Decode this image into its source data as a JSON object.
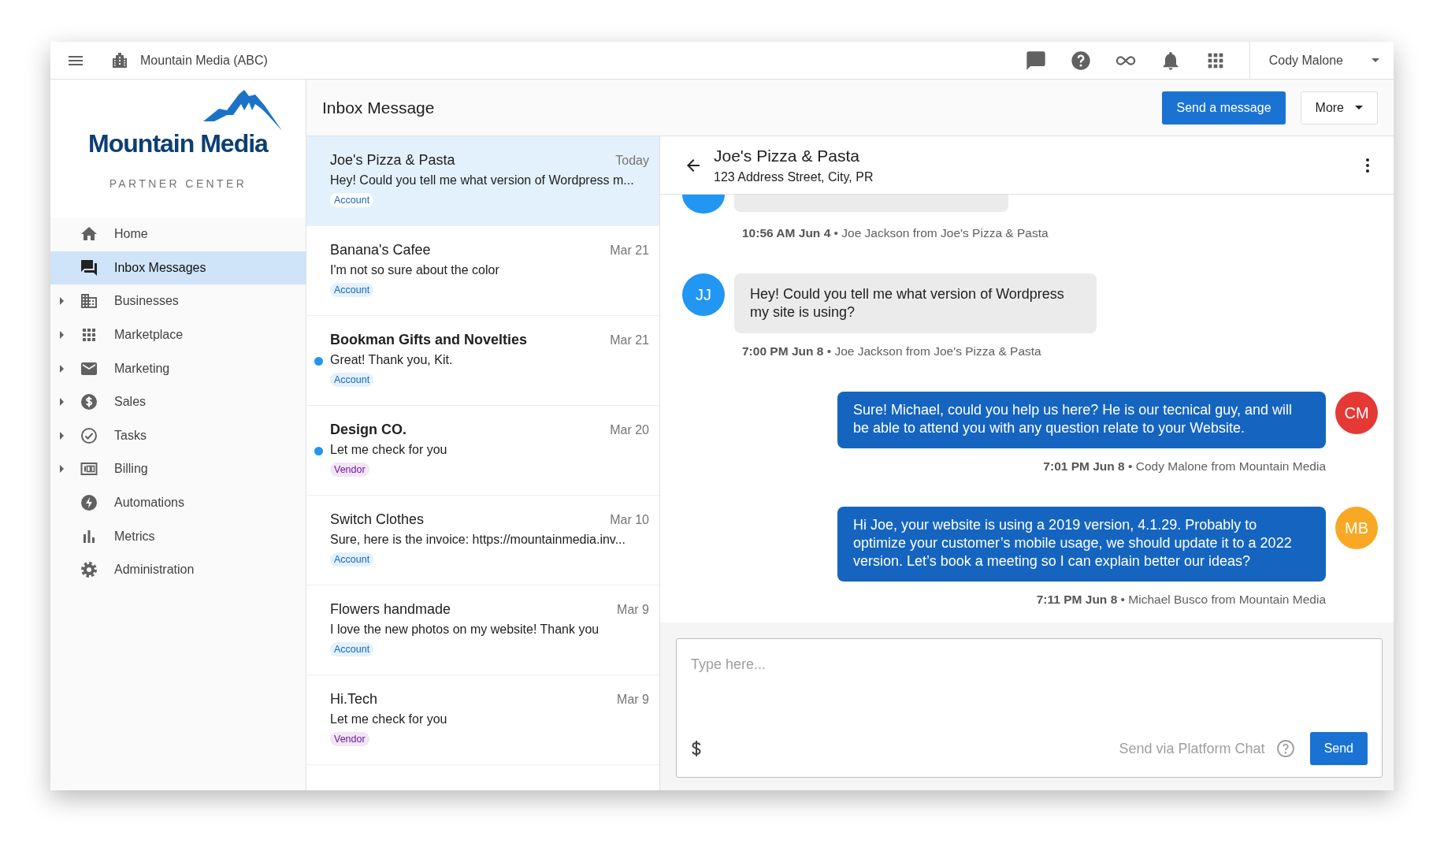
{
  "topbar": {
    "org": "Mountain Media (ABC)",
    "user": "Cody Malone"
  },
  "logo": {
    "name": "Mountain Media",
    "subtitle": "PARTNER CENTER"
  },
  "sidebar": {
    "items": [
      {
        "label": "Home",
        "expandable": false,
        "selected": false
      },
      {
        "label": "Inbox Messages",
        "expandable": false,
        "selected": true
      },
      {
        "label": "Businesses",
        "expandable": true,
        "selected": false
      },
      {
        "label": "Marketplace",
        "expandable": true,
        "selected": false
      },
      {
        "label": "Marketing",
        "expandable": true,
        "selected": false
      },
      {
        "label": "Sales",
        "expandable": true,
        "selected": false
      },
      {
        "label": "Tasks",
        "expandable": true,
        "selected": false
      },
      {
        "label": "Billing",
        "expandable": true,
        "selected": false
      },
      {
        "label": "Automations",
        "expandable": false,
        "selected": false
      },
      {
        "label": "Metrics",
        "expandable": false,
        "selected": false
      },
      {
        "label": "Administration",
        "expandable": false,
        "selected": false
      }
    ]
  },
  "page": {
    "title": "Inbox Message",
    "buttons": [
      {
        "label": "Send a message",
        "kind": "primary"
      },
      {
        "label": "More",
        "kind": "menu"
      }
    ]
  },
  "conversations": [
    {
      "name": "Joe's Pizza & Pasta",
      "date": "Today",
      "preview": "Hey! Could you tell me what version of Wordpress m...",
      "tag": {
        "label": "Account",
        "kind": "account"
      },
      "unread": false,
      "selected": true
    },
    {
      "name": "Banana's Cafee",
      "date": "Mar 21",
      "preview": "I'm not so sure about the color",
      "tag": {
        "label": "Account",
        "kind": "account"
      },
      "unread": false,
      "selected": false
    },
    {
      "name": "Bookman Gifts and Novelties",
      "date": "Mar 21",
      "preview": "Great! Thank you, Kit.",
      "tag": {
        "label": "Account",
        "kind": "account"
      },
      "unread": true,
      "selected": false
    },
    {
      "name": "Design CO.",
      "date": "Mar 20",
      "preview": "Let me check for you",
      "tag": {
        "label": "Vendor",
        "kind": "vendor"
      },
      "unread": true,
      "selected": false
    },
    {
      "name": "Switch Clothes",
      "date": "Mar 10",
      "preview": "Sure, here is the invoice: https://mountainmedia.inv...",
      "tag": {
        "label": "Account",
        "kind": "account"
      },
      "unread": false,
      "selected": false
    },
    {
      "name": "Flowers handmade",
      "date": "Mar 9",
      "preview": "I love the new photos on my website! Thank you",
      "tag": {
        "label": "Account",
        "kind": "account"
      },
      "unread": false,
      "selected": false
    },
    {
      "name": "Hi.Tech",
      "date": "Mar 9",
      "preview": "Let me check for you",
      "tag": {
        "label": "Vendor",
        "kind": "vendor"
      },
      "unread": false,
      "selected": false
    }
  ],
  "chat": {
    "title": "Joe's Pizza & Pasta",
    "address": "123 Address Street, City, PR",
    "messages": [
      {
        "kind": "incoming-partial",
        "avatar": {
          "color": "#2196f3"
        },
        "meta": "**10:56 AM Jun 4** • Joe Jackson from Joe's Pizza & Pasta"
      },
      {
        "kind": "incoming",
        "avatar": {
          "initials": "JJ",
          "color": "#2196f3"
        },
        "text": "Hey! Could you tell me what version of Wordpress my site is using?",
        "meta": "**7:00 PM Jun 8** • Joe Jackson from Joe's Pizza & Pasta"
      },
      {
        "kind": "outgoing",
        "avatar": {
          "initials": "CM",
          "color": "#e53935"
        },
        "text": "Sure! Michael, could you help us here? He is our tecnical guy, and will be able to attend you with any question relate to your Website.",
        "meta": "**7:01 PM Jun 8** • Cody Malone from Mountain Media"
      },
      {
        "kind": "outgoing",
        "avatar": {
          "initials": "MB",
          "color": "#f9a825"
        },
        "text": "Hi Joe, your website is using a 2019 version, 4.1.29. Probably to optimize your customer’s mobile usage, we should update it to a 2022 version. Let’s book a meeting so I can explain better our ideas?",
        "meta": "**7:11 PM Jun 8** • Michael Busco from Mountain Media"
      }
    ],
    "composer": {
      "placeholder": "Type here...",
      "channel": "Send via Platform Chat",
      "send": "Send"
    }
  }
}
